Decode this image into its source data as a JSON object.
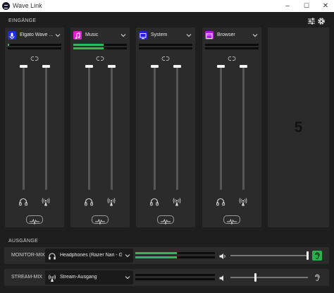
{
  "window": {
    "title": "Wave Link",
    "minimize": "–",
    "maximize": "☐",
    "close": "✕"
  },
  "inputs_section": {
    "label": "EINGÄNGE",
    "channels": [
      {
        "name": "Elgato Wave ...",
        "icon": "microphone-icon",
        "color": "#1e2fd9",
        "meter_left": 0.03,
        "meter_right": 0.0,
        "slider_1": 1.0,
        "slider_2": 1.0
      },
      {
        "name": "Music",
        "icon": "music-note-icon",
        "color": "#e020d0",
        "meter_left": 0.56,
        "meter_right": 0.56,
        "slider_1": 1.0,
        "slider_2": 1.0
      },
      {
        "name": "System",
        "icon": "monitor-icon",
        "color": "#2a1fe0",
        "meter_left": 0.0,
        "meter_right": 0.0,
        "slider_1": 1.0,
        "slider_2": 1.0
      },
      {
        "name": "Browser",
        "icon": "browser-window-icon",
        "color": "#b01ce0",
        "meter_left": 0.0,
        "meter_right": 0.0,
        "slider_1": 1.0,
        "slider_2": 1.0
      }
    ],
    "empty_slot": "5"
  },
  "outputs_section": {
    "label": "AUSGÄNGE",
    "rows": [
      {
        "label": "MONITOR-MIX",
        "device": "Headphones (Razer Nari - G...",
        "device_icon": "headphones-icon",
        "meter_left": 0.52,
        "meter_right": 0.52,
        "volume": 1.0,
        "listen_active": true,
        "listen_color": "#27b24a"
      },
      {
        "label": "STREAM-MIX",
        "device": "Stream-Ausgang",
        "device_icon": "broadcast-icon",
        "meter_left": 0.0,
        "meter_right": 0.0,
        "volume": 0.33,
        "listen_active": false,
        "listen_color": "#2b2b2b"
      }
    ]
  },
  "colors": {
    "accent_green": "#2fb85a",
    "panel": "#2b2b2b",
    "background": "#1e1e1e"
  }
}
